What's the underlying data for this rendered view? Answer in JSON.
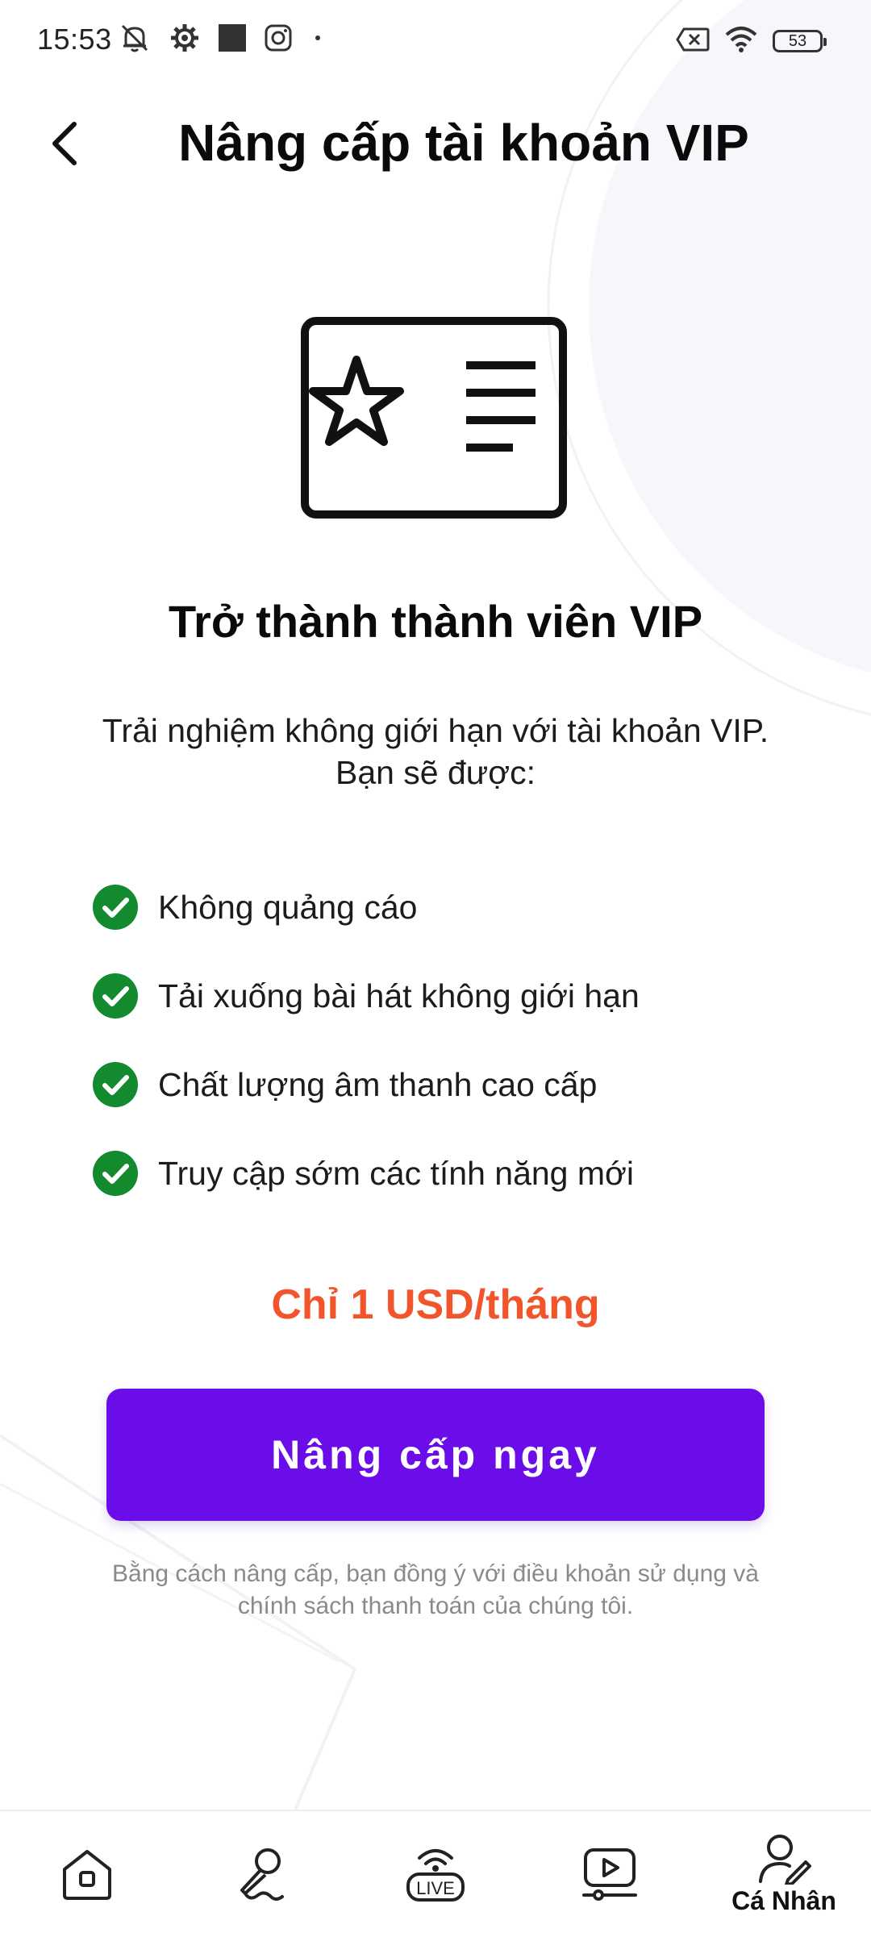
{
  "status_bar": {
    "time": "15:53",
    "battery_level": "53",
    "icons_left": [
      "bell-muted-icon",
      "gear-icon",
      "square-icon",
      "instagram-icon",
      "dot-icon"
    ],
    "icons_right": [
      "sim-error-icon",
      "wifi-icon",
      "battery-icon"
    ]
  },
  "header": {
    "title": "Nâng cấp tài khoản VIP",
    "back_icon": "chevron-left-icon"
  },
  "hero": {
    "icon": "vip-card-icon",
    "headline": "Trở thành thành viên VIP",
    "description_line1": "Trải nghiệm không giới hạn với tài khoản VIP.",
    "description_line2": "Bạn sẽ được:"
  },
  "benefits": [
    {
      "label": "Không quảng cáo"
    },
    {
      "label": "Tải xuống bài hát không giới hạn"
    },
    {
      "label": "Chất lượng âm thanh cao cấp"
    },
    {
      "label": "Truy cập sớm các tính năng mới"
    }
  ],
  "pricing": {
    "price_text": "Chỉ 1 USD/tháng"
  },
  "cta": {
    "button_label": "Nâng cấp ngay"
  },
  "terms": {
    "line1": "Bằng cách nâng cấp, bạn đồng ý với điều khoản sử dụng và",
    "line2": "chính sách thanh toán của chúng tôi."
  },
  "bottom_nav": {
    "items": [
      {
        "icon": "home-icon",
        "label": ""
      },
      {
        "icon": "microphone-icon",
        "label": ""
      },
      {
        "icon": "live-icon",
        "label": "",
        "badge": "LIVE"
      },
      {
        "icon": "video-play-icon",
        "label": ""
      },
      {
        "icon": "profile-edit-icon",
        "label": "Cá Nhân"
      }
    ]
  },
  "colors": {
    "accent": "#6a0de8",
    "price": "#f2552c",
    "check": "#138a2e",
    "text": "#111111",
    "muted": "#8a8a8a"
  }
}
